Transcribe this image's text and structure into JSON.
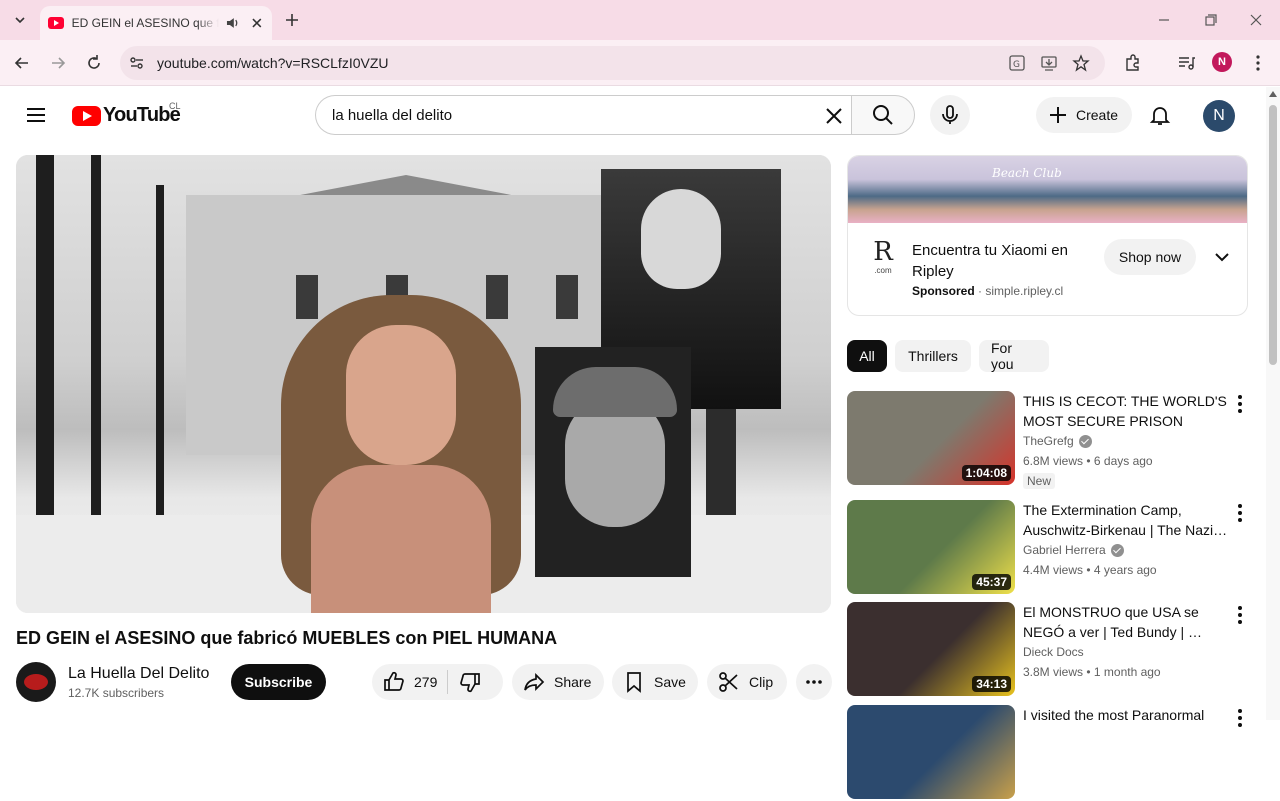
{
  "browser": {
    "tab_title": "ED GEIN el ASESINO que fabricó MUEBLES con PIEL HUMANA - YouTube",
    "url": "youtube.com/watch?v=RSCLfzI0VZU",
    "profile_initial": "N"
  },
  "masthead": {
    "logo_text": "YouTube",
    "country_code": "CL",
    "search_value": "la huella del delito",
    "create_label": "Create",
    "avatar_initial": "N"
  },
  "video": {
    "title": "ED GEIN el ASESINO que fabricó MUEBLES con PIEL HUMANA",
    "channel_name": "La Huella Del Delito",
    "subscribers": "12.7K subscribers",
    "subscribe_label": "Subscribe",
    "likes": "279",
    "share_label": "Share",
    "save_label": "Save",
    "clip_label": "Clip"
  },
  "ad": {
    "banner_brand": "Beach Club",
    "title": "Encuentra tu Xiaomi en Ripley",
    "sponsored_label": "Sponsored",
    "domain": "simple.ripley.cl",
    "cta": "Shop now",
    "logo_letter": "R",
    "logo_suffix": ".com"
  },
  "chips": [
    "All",
    "Thrillers",
    "For you"
  ],
  "recommendations": [
    {
      "title": "THIS IS CECOT: THE WORLD'S MOST SECURE PRISON",
      "channel": "TheGrefg",
      "verified": true,
      "meta": "6.8M views • 6 days ago",
      "badge": "New",
      "duration": "1:04:08",
      "thumb_colors": [
        "#7d7a6e",
        "#d6332a"
      ]
    },
    {
      "title": "The Extermination Camp, Auschwitz-Birkenau | The Nazi…",
      "channel": "Gabriel Herrera",
      "verified": true,
      "meta": "4.4M views • 4 years ago",
      "badge": "",
      "duration": "45:37",
      "thumb_colors": [
        "#5e7a4a",
        "#efe04a"
      ]
    },
    {
      "title": "El MONSTRUO que USA se NEGÓ a ver | Ted Bundy | …",
      "channel": "Dieck Docs",
      "verified": false,
      "meta": "3.8M views • 1 month ago",
      "badge": "",
      "duration": "34:13",
      "thumb_colors": [
        "#3b2f2f",
        "#e8c21e"
      ]
    },
    {
      "title": "I visited the most Paranormal",
      "channel": "",
      "verified": false,
      "meta": "",
      "badge": "",
      "duration": "",
      "thumb_colors": [
        "#2c4a6e",
        "#c9a04a"
      ]
    }
  ]
}
